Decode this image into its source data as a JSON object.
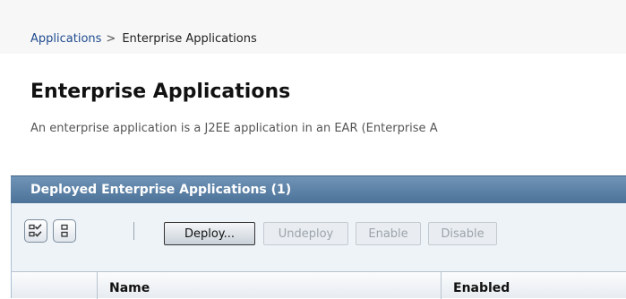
{
  "breadcrumb": {
    "link": "Applications",
    "separator": ">",
    "current": "Enterprise Applications"
  },
  "page": {
    "title": "Enterprise Applications",
    "description": "An enterprise application is a J2EE application in an EAR (Enterprise A"
  },
  "panel": {
    "title": "Deployed Enterprise Applications (1)"
  },
  "toolbar": {
    "select_all_icon": "select-all-checkbox-icon",
    "deselect_all_icon": "deselect-all-checkbox-icon",
    "deploy_label": "Deploy...",
    "undeploy_label": "Undeploy",
    "enable_label": "Enable",
    "disable_label": "Disable"
  },
  "table": {
    "columns": [
      "",
      "Name",
      "Enabled"
    ]
  },
  "colors": {
    "link": "#1f4b8f",
    "panel_header": "#5b7fa6",
    "toolbar_bg": "#eef3f8"
  }
}
